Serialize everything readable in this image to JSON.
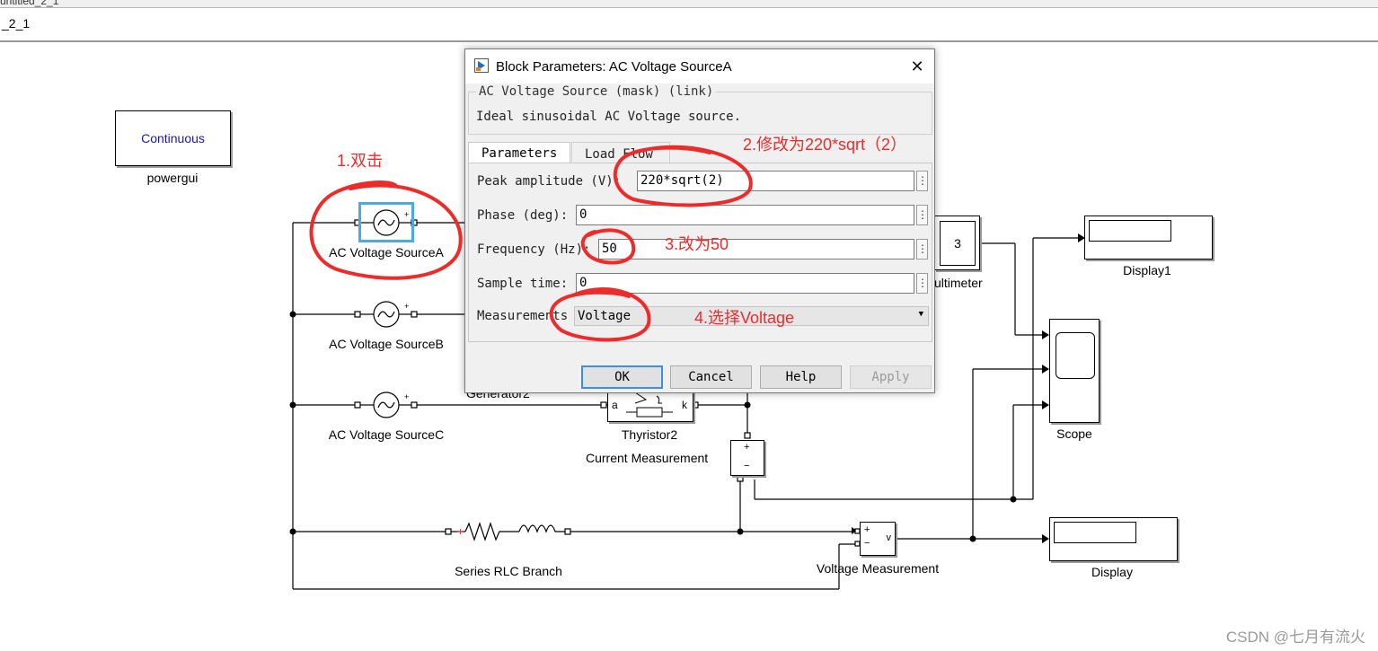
{
  "window": {
    "tab_fragment": "untitled_2_1",
    "path": "_2_1"
  },
  "diagram": {
    "powergui_block": "Continuous",
    "powergui_label": "powergui",
    "source_a": "AC Voltage SourceA",
    "source_b": "AC Voltage SourceB",
    "source_c": "AC Voltage SourceC",
    "generator_label": "Generator2",
    "thyristor_label": "Thyristor2",
    "thyristor_port_a": "a",
    "thyristor_port_k": "k",
    "current_measurement": "Current Measurement",
    "rlc_label": "Series RLC Branch",
    "voltage_measurement": "Voltage Measurement",
    "voltage_port": "v",
    "multimeter_label": "ultimeter",
    "multimeter_value": "3",
    "display1_label": "Display1",
    "display_label": "Display",
    "scope_label": "Scope"
  },
  "dialog": {
    "title": "Block Parameters: AC Voltage SourceA",
    "group_title": "AC Voltage Source (mask) (link)",
    "description": "Ideal sinusoidal AC Voltage source.",
    "tabs": [
      {
        "label": "Parameters",
        "active": true
      },
      {
        "label": "Load Flow",
        "active": false
      }
    ],
    "params": {
      "peak_label": "Peak amplitude (V):",
      "peak_value": "220*sqrt(2)",
      "phase_label": "Phase (deg):",
      "phase_value": "0",
      "freq_label": "Frequency (Hz):",
      "freq_value": "50",
      "sample_label": "Sample time:",
      "sample_value": "0",
      "meas_label": "Measurements",
      "meas_value": "Voltage"
    },
    "buttons": {
      "ok": "OK",
      "cancel": "Cancel",
      "help": "Help",
      "apply": "Apply"
    }
  },
  "annotations": {
    "step1": "1.双击",
    "step2": "2.修改为220*sqrt（2）",
    "step3": "3.改为50",
    "step4": "4.选择Voltage",
    "color": "#ee2b2b"
  },
  "watermark": "CSDN @七月有流火",
  "colors": {
    "selection": "#4aa8f0",
    "annotation": "#ee2b2b"
  }
}
